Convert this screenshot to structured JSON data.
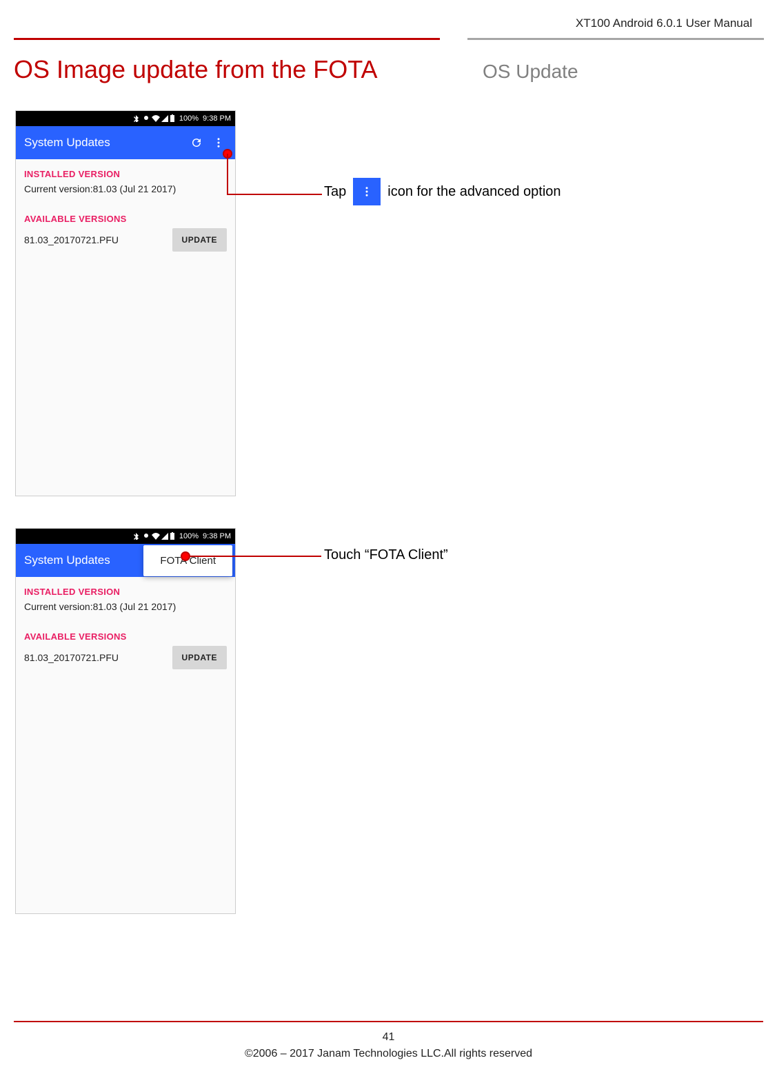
{
  "header_running": "XT100 Android 6.0.1 User Manual",
  "page_title": "OS Image update from the FOTA",
  "section_title": "OS Update",
  "statusbar": {
    "battery": "100%",
    "time": "9:38 PM"
  },
  "appbar": {
    "title": "System Updates"
  },
  "installed": {
    "label": "INSTALLED VERSION",
    "value": "Current version:81.03 (Jul 21 2017)"
  },
  "available": {
    "label": "AVAILABLE VERSIONS",
    "value": "81.03_20170721.PFU",
    "button": "UPDATE"
  },
  "menu_popup": "FOTA Client",
  "instr1_pre": "Tap",
  "instr1_post": "icon for the advanced option",
  "instr2": "Touch “FOTA Client”",
  "footer_page": "41",
  "footer_copy": "©2006 – 2017 Janam Technologies LLC.All rights reserved"
}
